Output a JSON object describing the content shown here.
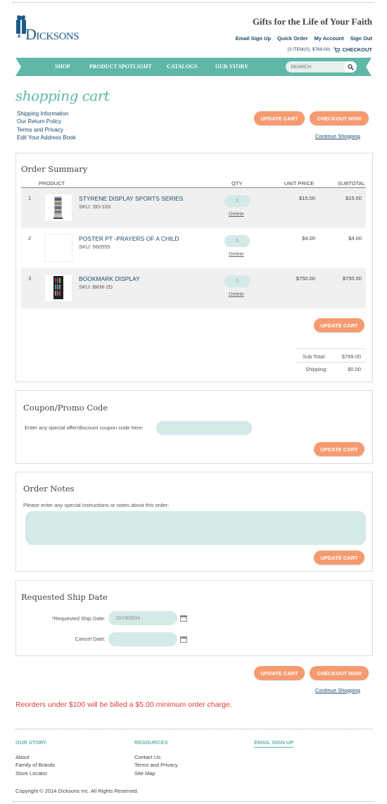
{
  "brand": {
    "name": "Dicksons",
    "tagline": "Gifts for the Life of Your Faith",
    "accent": "#5fb7a7",
    "link_color": "#1b4b6e",
    "button_color": "#f59b6f"
  },
  "toplinks": [
    "Email Sign Up",
    "Quick Order",
    "My Account",
    "Sign Out"
  ],
  "cart_summary": "(3 ITEM(S), $769.00)",
  "checkout_link": "CHECKOUT",
  "nav": {
    "items": [
      "SHOP",
      "PRODUCT SPOTLIGHT",
      "CATALOGS",
      "OUR STORY"
    ],
    "search_placeholder": "SEARCH"
  },
  "page_title": "shopping cart",
  "sidelinks": [
    "Shipping Information",
    "Our Return Policy",
    "Terms and Privacy",
    "Edit Your Address Book"
  ],
  "buttons": {
    "update": "UPDATE CART",
    "checkout": "CHECKOUT NOW",
    "continue": "Continue Shopping"
  },
  "order": {
    "title": "Order Summary",
    "headers": {
      "product": "PRODUCT",
      "qty": "QTY",
      "unit": "UNIT PRICE",
      "subtotal": "SUBTOTAL"
    },
    "items": [
      {
        "num": "1",
        "name": "STYRENE DISPLAY SPORTS SERIES",
        "sku": "SKU: SD-103",
        "qty": "1",
        "delete": "Delete",
        "unit": "$15.00",
        "subtotal": "$15.00"
      },
      {
        "num": "2",
        "name": "POSTER PT -PRAYERS OF A CHILD",
        "sku": "SKU: 560555",
        "qty": "1",
        "delete": "Delete",
        "unit": "$4.00",
        "subtotal": "$4.00"
      },
      {
        "num": "3",
        "name": "BOOKMARK DISPLAY",
        "sku": "SKU: BKM-2D",
        "qty": "1",
        "delete": "Delete",
        "unit": "$750.00",
        "subtotal": "$750.00"
      }
    ],
    "subtotal_label": "Sub Total:",
    "subtotal": "$769.00",
    "shipping_label": "Shipping:",
    "shipping": "$0.00"
  },
  "coupon": {
    "title": "Coupon/Promo Code",
    "label": "Enter any special offer/discount coupon code here:",
    "value": ""
  },
  "notes": {
    "title": "Order Notes",
    "label": "Please enter any special instructions or notes about this order:",
    "value": ""
  },
  "ship": {
    "title": "Requested Ship Date",
    "req_label": "*Requested Ship Date:",
    "req_value": "10/19/2014",
    "cancel_label": "Cancel Date:",
    "cancel_value": ""
  },
  "warning": "Reorders under $100 will be billed a $5.00 minimum order charge.",
  "footer": {
    "cols": [
      {
        "title": "OUR STORY",
        "links": [
          "About",
          "Family of Brands",
          "Store Locator"
        ]
      },
      {
        "title": "RESOURCES",
        "links": [
          "Contact Us",
          "Terms and Privacy",
          "Site Map"
        ]
      },
      {
        "title": "EMAIL SIGN UP",
        "links": []
      }
    ],
    "copyright": "Copyright © 2014 Dicksons Inc. All Rights Reserved."
  }
}
